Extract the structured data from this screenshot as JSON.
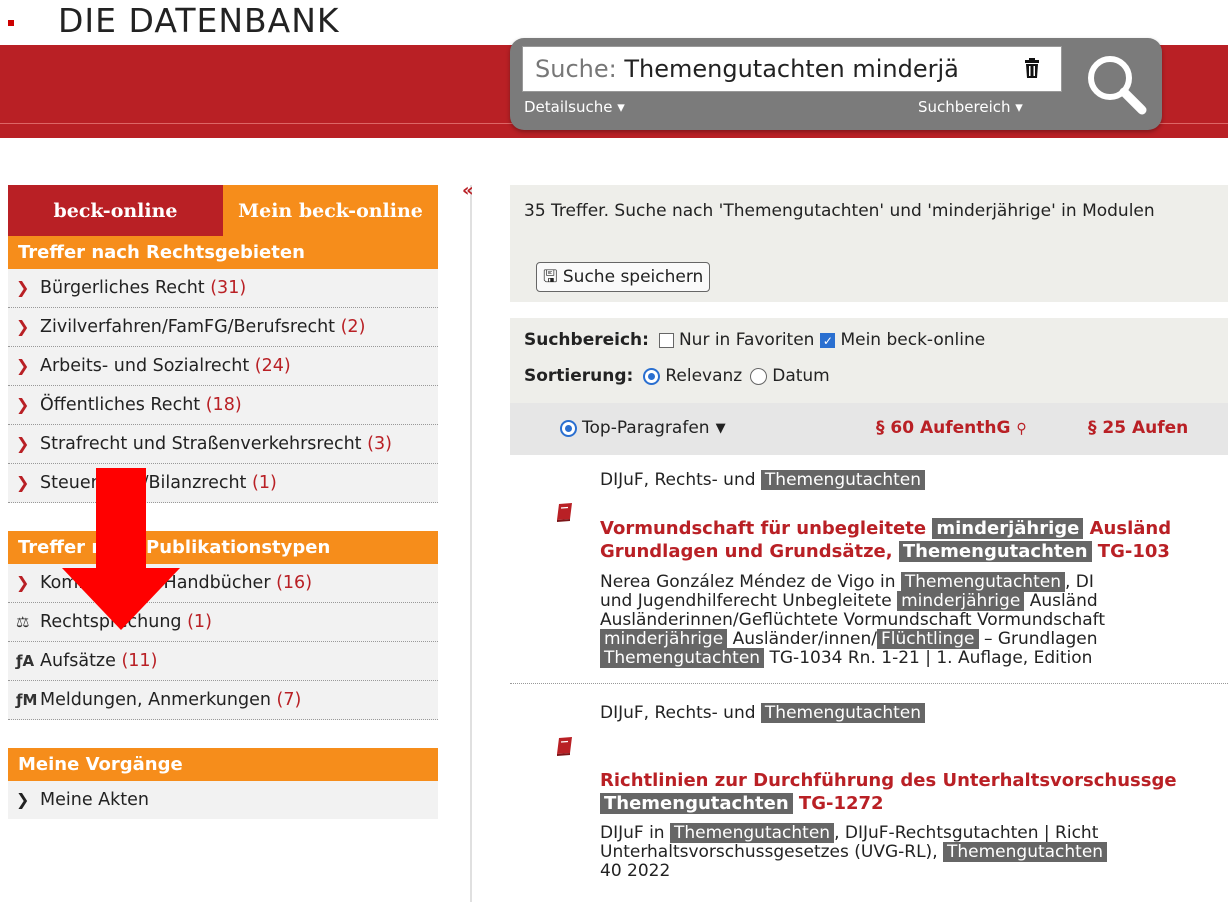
{
  "header": {
    "brand": "DIE DATENBANK",
    "search_label": "Suche:",
    "search_value": "Themengutachten minderjä",
    "detail_search": "Detailsuche ▾",
    "search_scope": "Suchbereich ▾"
  },
  "sidebar": {
    "tabs": [
      "beck-online",
      "Mein beck-online"
    ],
    "areas_title": "Treffer nach Rechtsgebieten",
    "areas": [
      {
        "label": "Bürgerliches Recht",
        "count": "(31)"
      },
      {
        "label": "Zivilverfahren/FamFG/Berufsrecht",
        "count": "(2)"
      },
      {
        "label": "Arbeits- und Sozialrecht",
        "count": "(24)"
      },
      {
        "label": "Öffentliches Recht",
        "count": "(18)"
      },
      {
        "label": "Strafrecht und Straßenverkehrsrecht",
        "count": "(3)"
      },
      {
        "label": "Steuerrecht/Bilanzrecht",
        "count": "(1)"
      }
    ],
    "types_title": "Treffer nach Publikationstypen",
    "types": [
      {
        "label": "Kommentare, Handbücher",
        "count": "(16)",
        "icon": "chevron-icon"
      },
      {
        "label": "Rechtsprechung",
        "count": "(1)",
        "icon": "scales-icon"
      },
      {
        "label": "Aufsätze",
        "count": "(11)",
        "icon": "article-icon"
      },
      {
        "label": "Meldungen, Anmerkungen",
        "count": "(7)",
        "icon": "news-icon"
      }
    ],
    "proc_title": "Meine Vorgänge",
    "proc_items": [
      "Meine Akten"
    ]
  },
  "results": {
    "summary": "35 Treffer. Suche nach 'Themengutachten' und 'minderjährige' in Modulen",
    "save_label": "Suche speichern",
    "scope_label": "Suchbereich:",
    "fav_label": "Nur in Favoriten",
    "mine_label": "Mein beck-online",
    "sort_label": "Sortierung:",
    "sort_relevance": "Relevanz",
    "sort_date": "Datum",
    "top_para": "Top-Paragrafen",
    "para1": "§ 60 AufenthG",
    "para2": "§ 25 Aufen",
    "hits": [
      {
        "source_a": "DIJuF, Rechts- und",
        "source_hl": "Themengutachten",
        "title_1a": "Vormundschaft für unbegleitete",
        "title_1hl": "minderjährige",
        "title_1b": "Ausländ",
        "title_2a": "Grundlagen und Grundsätze,",
        "title_2hl": "Themengutachten",
        "title_2b": "TG-103",
        "d1a": "Nerea González Méndez de Vigo in",
        "d1hl": "Themengutachten",
        "d1b": ", DI",
        "d2a": "und Jugendhilferecht Unbegleitete",
        "d2hl": "minderjährige",
        "d2b": "Ausländ",
        "d3": "Ausländerinnen/Geflüchtete Vormundschaft Vormundschaft",
        "d4hl": "minderjährige",
        "d4a": "Ausländer/innen/",
        "d4hl2": "Flüchtlinge",
        "d4b": "– Grundlagen",
        "d5hl": "Themengutachten",
        "d5a": "TG-1034 Rn. 1-21 | 1. Auflage, Edition"
      },
      {
        "source_a": "DIJuF, Rechts- und",
        "source_hl": "Themengutachten",
        "title_1a": "Richtlinien zur Durchführung des Unterhaltsvorschussge",
        "title_2hl": "Themengutachten",
        "title_2b": "TG-1272",
        "d1a": "DIJuF in",
        "d1hl": "Themengutachten",
        "d1b": ", DIJuF-Rechtsgutachten | Richt",
        "d2a": "Unterhaltsvorschussgesetzes (UVG-RL),",
        "d2hl": "Themengutachten",
        "d3": "40 2022"
      }
    ]
  },
  "colors": {
    "brand_red": "#b92025",
    "accent_orange": "#f68d1b",
    "highlight_gray": "#666666"
  }
}
